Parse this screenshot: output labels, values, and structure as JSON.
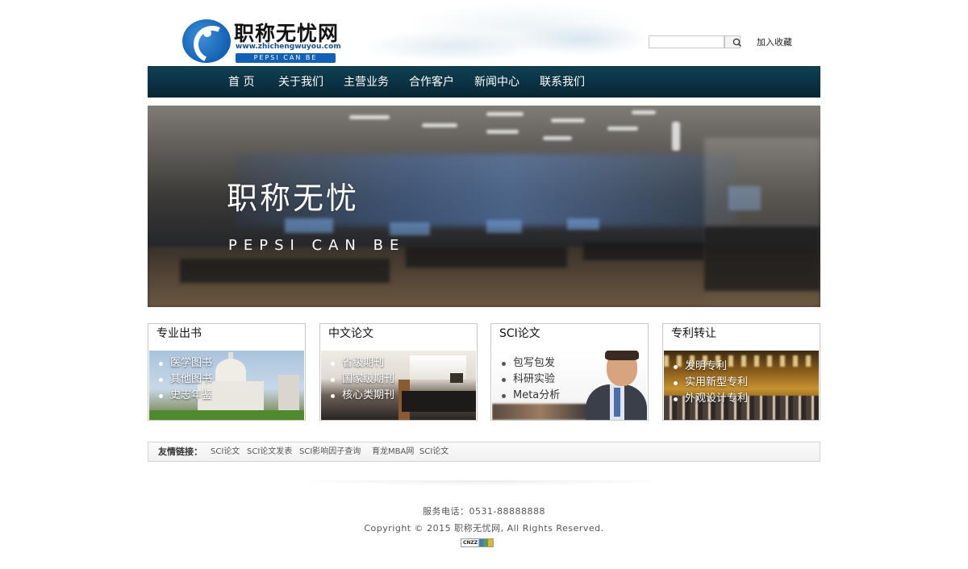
{
  "header": {
    "logo_title": "职称无忧网",
    "logo_url": "www.zhichengwuyou.com",
    "logo_slogan": "PEPSI CAN BE",
    "search_placeholder": "",
    "add_favorite": "加入收藏"
  },
  "nav": {
    "items": [
      {
        "label": "首  页"
      },
      {
        "label": "关于我们"
      },
      {
        "label": "主营业务"
      },
      {
        "label": "合作客户"
      },
      {
        "label": "新闻中心"
      },
      {
        "label": "联系我们"
      }
    ]
  },
  "banner": {
    "title": "职称无忧",
    "subtitle": "PEPSI CAN BE"
  },
  "services": [
    {
      "title": "专业出书",
      "items": [
        "医学图书",
        "其他图书",
        "史志年鉴"
      ]
    },
    {
      "title": "中文论文",
      "items": [
        "省级期刊",
        "国家级期刊",
        "核心类期刊"
      ]
    },
    {
      "title": "SCI论文",
      "items": [
        "包写包发",
        "科研实验",
        "Meta分析"
      ]
    },
    {
      "title": "专利转让",
      "items": [
        "发明专利",
        "实用新型专利",
        "外观设计专利"
      ]
    }
  ],
  "friend_links": {
    "label": "友情链接：",
    "items": [
      "SCI论文",
      "SCI论文发表",
      "SCI影响因子查询",
      "育龙MBA网",
      "SCI论文"
    ]
  },
  "footer": {
    "phone": "服务电话：0531-88888888",
    "copyright": "Copyright © 2015 职称无忧网, All Rights Reserved.",
    "badge": "CNZZ"
  },
  "colors": {
    "nav_bg": "#0b3142",
    "brand_blue": "#1461b3"
  }
}
